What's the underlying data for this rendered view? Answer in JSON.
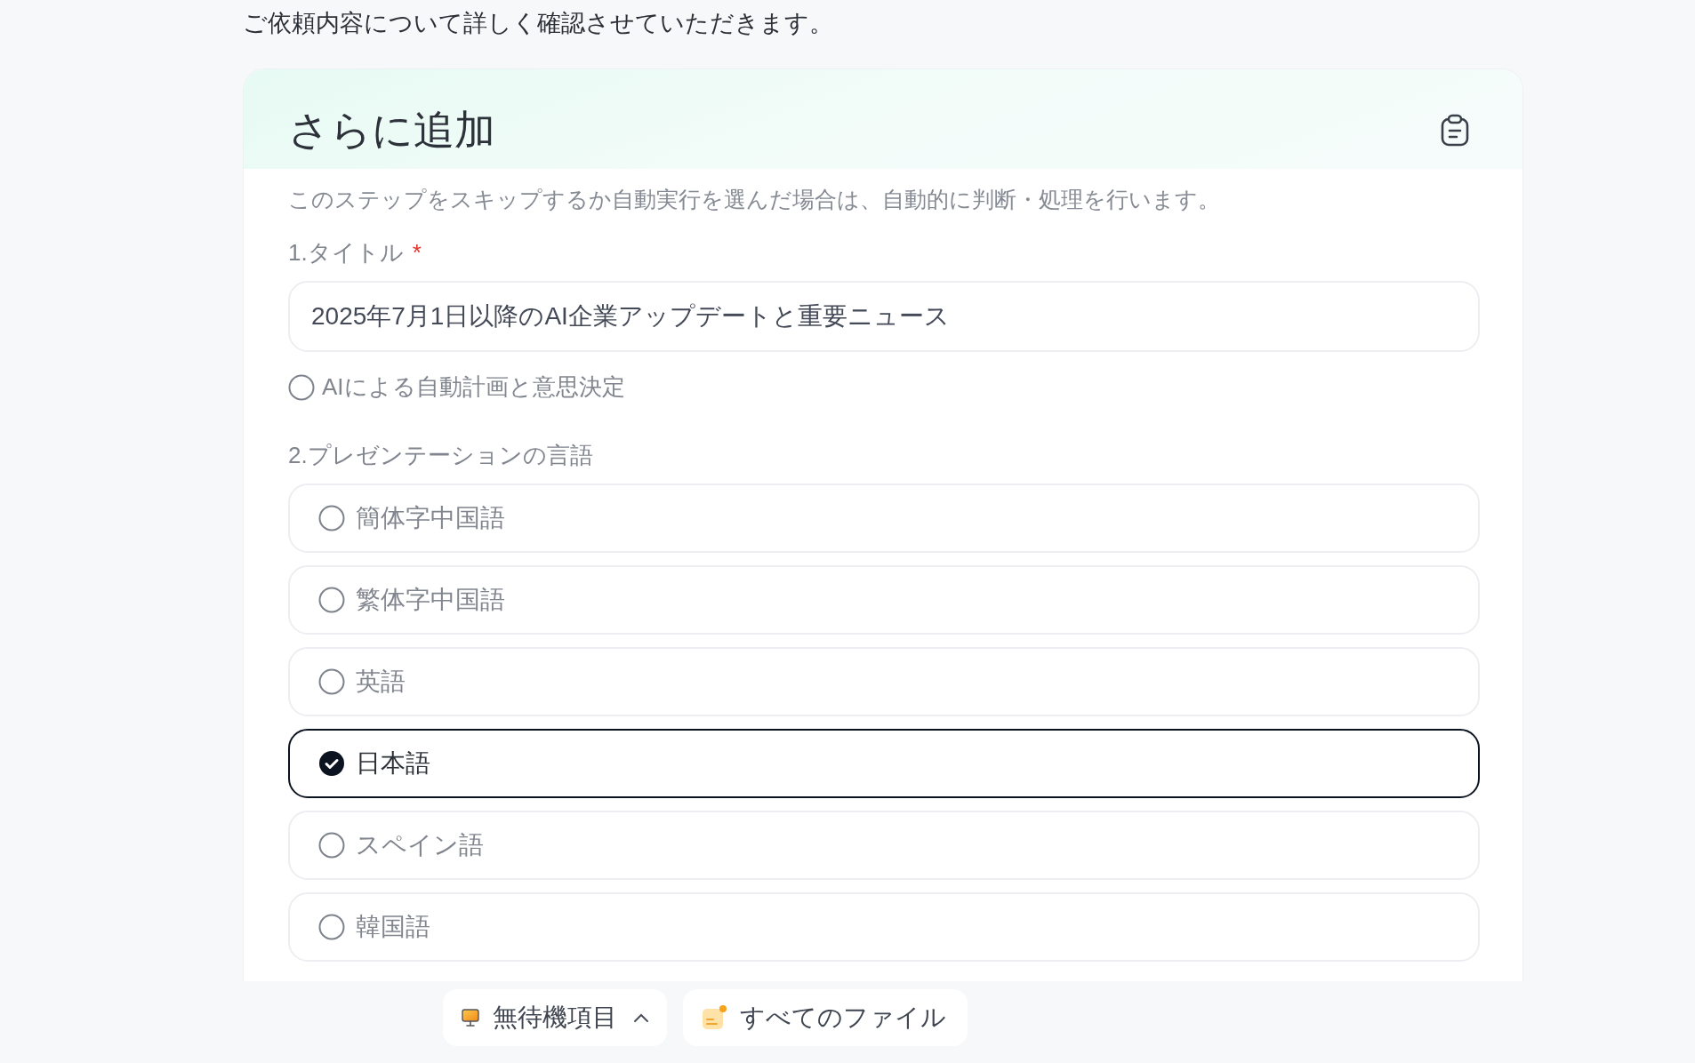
{
  "intro": "ご依頼内容について詳しく確認させていただきます。",
  "card": {
    "title": "さらに追加",
    "description": "このステップをスキップするか自動実行を選んだ場合は、自動的に判断・処理を行います。",
    "title_field": {
      "label": "1.タイトル",
      "required_mark": "*",
      "value": "2025年7月1日以降のAI企業アップデートと重要ニュース"
    },
    "auto_option": {
      "label": "AIによる自動計画と意思決定",
      "selected": false
    },
    "language_question": {
      "label": "2.プレゼンテーションの言語",
      "options": [
        {
          "label": "簡体字中国語",
          "selected": false
        },
        {
          "label": "繁体字中国語",
          "selected": false
        },
        {
          "label": "英語",
          "selected": false
        },
        {
          "label": "日本語",
          "selected": true
        },
        {
          "label": "スペイン語",
          "selected": false
        },
        {
          "label": "韓国語",
          "selected": false
        }
      ]
    }
  },
  "bottom_bar": [
    {
      "kind": "tasks",
      "label": "無待機項目",
      "expanded": false
    },
    {
      "kind": "files",
      "label": "すべてのファイル"
    }
  ]
}
